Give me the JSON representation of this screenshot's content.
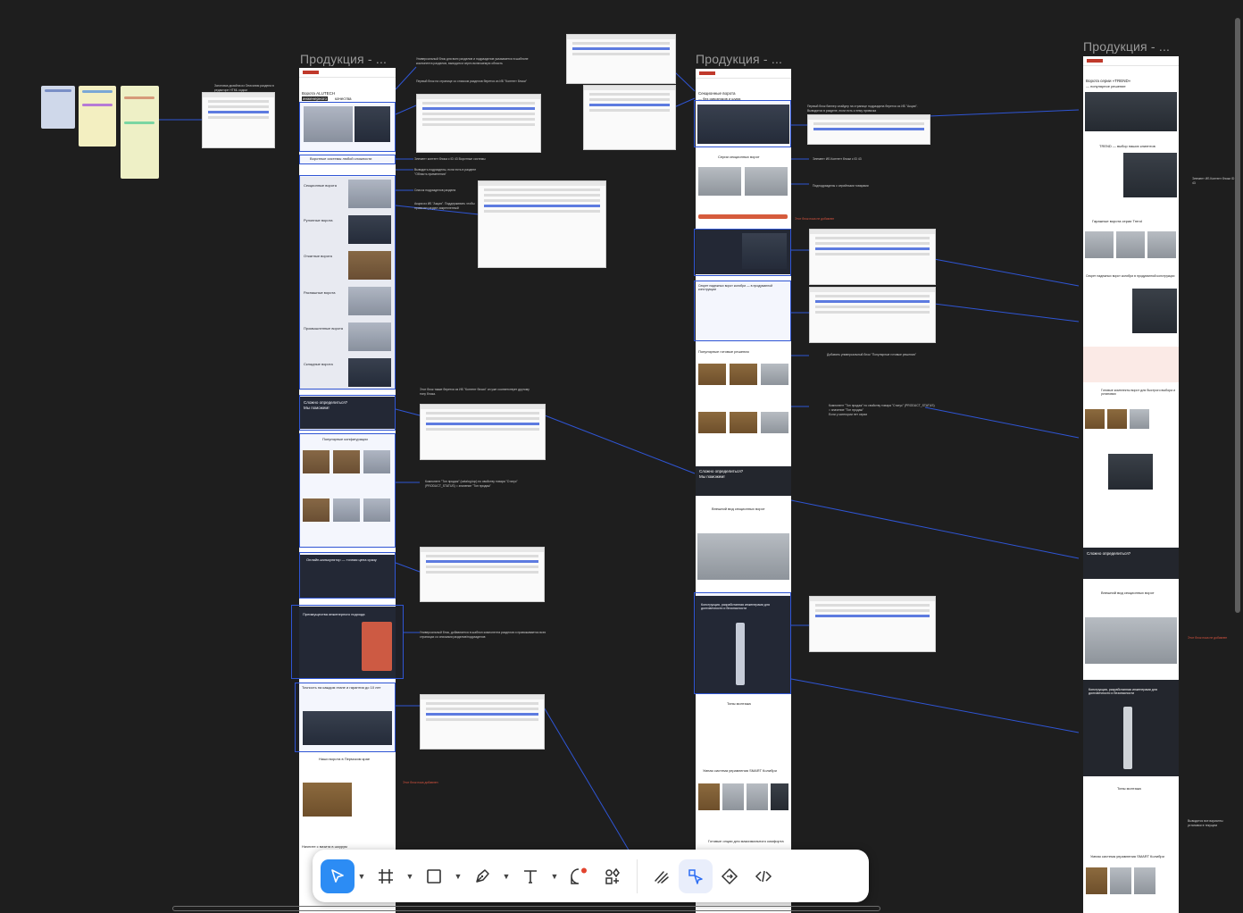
{
  "frames": [
    {
      "title": "Продукция - ..."
    },
    {
      "title": "Продукция - ..."
    },
    {
      "title": "Продукция - ..."
    }
  ],
  "left_page": {
    "hero_title": "Ворота ALUTECH",
    "hero_badge": "инженерного",
    "hero_rest": "качества",
    "systems_title": "Воротные системы любой сложности",
    "consult_title": "Сложно определиться?",
    "consult_sub": "Мы поможем!",
    "popular_title": "Популярные конфигурации",
    "calc_title": "Онлайн-калькулятор — точная цена сразу",
    "advantages_title": "Преимущества инженерного подхода",
    "precision_title": "Точность на каждом этапе и гарантия до 10 лет",
    "works_title": "Наши ворота в Пермском крае",
    "start_title": "Начните с визита в шоурум",
    "categories": [
      "Секционные ворота",
      "Рулонные ворота",
      "Откатные ворота",
      "Распашные ворота",
      "Промышленные ворота",
      "Складные ворота"
    ]
  },
  "mid_page": {
    "hero_title": "Секционные ворота",
    "hero_sub": "— без сквозняков и шума",
    "series_title": "Серии секционных ворот",
    "secret_title": "Секрет надежных ворот колибри — в продуманной конструкции",
    "popular_title": "Популярные готовые решения",
    "consult_title": "Сложно определиться?",
    "consult_sub": "Мы поможем!",
    "look_title": "Внешний вид секционных ворот",
    "construct_title": "Конструкция, разработанная инженерами для долговечности и безопасности",
    "mount_title": "Типы монтажа",
    "smart_title": "Умная система управления SMART Колибри",
    "ready_title": "Готовые опции для максимального комфорта"
  },
  "right_page": {
    "hero_title": "Ворота серии «TREND»",
    "hero_sub": "— популярное решение",
    "choice_title": "TREND — выбор наших клиентов",
    "garage_title": "Гаражные ворота серии Trend",
    "secret_title": "Секрет надежных ворот колибри в продуманной конструкции",
    "kits_title": "Готовые комплекты ворот для быстрого выбора и установки",
    "consult_title": "Сложно определиться?",
    "look_title": "Внешний вид секционных ворот",
    "construct_title": "Конструкция, разработанная инженерами для долговечности и безопасности",
    "mount_title": "Типы монтажа",
    "smart_title": "Умная система управления SMART Колибри"
  },
  "notes": {
    "n1": "Универсальный блок для всех разделов и подразделов указывается в шаблоне компонента разделов, выводится через включаемую область",
    "n2": "Первый блок на странице со списком разделов берется из ИБ \"Контент блоки\"",
    "n3": "Элемент контент блока с ID 43 Воротные системы",
    "n4": "Выводить подразделы, если есть в разделе \"Область применения\"",
    "n5": "Список подразделов раздела",
    "n6": "Акция из ИБ \"Акция\". Поддерживать чтобы привязан раздел закрепленный",
    "n7": "Этот блок также берется из ИБ \"Контент блоки\" он уже соответствует другому типу блока.",
    "n8": "Компонент \"Топ продаж\" (catalog.top) по свойству товара \"Статус\" (PRODUCT_STATUS) = значение \"Топ продаж\"",
    "n9": "Универсальный блок, добавляется в шаблон компонента разделов и правоживается всех страницах со списками разделов/подразделов",
    "n10": "Этот блок пока добавлен",
    "n11": "Первый блок баннер слайдер на странице подраздела берется из ИБ \"Акция\". Выводятся в разделе, если есть к нему привязка",
    "n12": "Элемент ИБ Контент блоки с ID 43",
    "n13": "Подподразделы с серийными товарами",
    "n14": "Добавить универсальный блок \"Популярные готовые решения\"",
    "n15": "Компонент \"Топ продаж\" по свойству товара \"Статус\" (PRODUCT_STATUS) = значение \"Топ продаж\"",
    "n16": "Если у категории нет серии",
    "n17": "Этот блок пока не добавлен",
    "n18": "Элемент ИБ Контент блоки ID 43",
    "n19": "Выводится все варианты установки в текущем",
    "n20": "Этот блок пока не добавлен",
    "left_small": "Заготовка дизайна из Описания раздела в редакторе HTML кодом"
  },
  "toolbar": {
    "tools": [
      "move-tool",
      "frame-tool",
      "rectangle-tool",
      "pen-tool",
      "text-tool",
      "comment-tool",
      "assets-tool",
      "draw-mode",
      "design-mode",
      "prototype-mode",
      "dev-mode"
    ]
  },
  "colors": {
    "canvas": "#1e1e1e",
    "connector": "#2f55d4",
    "accent": "#2c8cf4",
    "brand": "#c0392b"
  }
}
